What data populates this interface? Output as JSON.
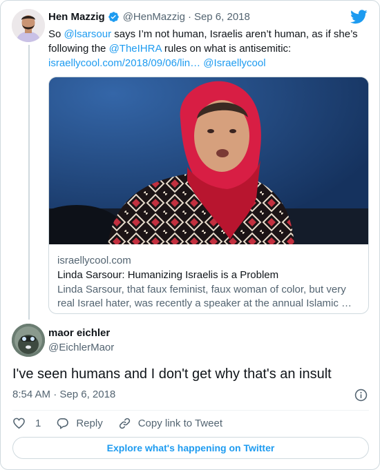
{
  "quoted_tweet": {
    "name": "Hen Mazzig",
    "handle": "@HenMazzig",
    "dot": "·",
    "date": "Sep 6, 2018",
    "text_1": "So ",
    "mention_1": "@lsarsour",
    "text_2": " says I’m not human, Israelis aren’t human, as if she’s following the ",
    "mention_2": "@TheIHRA",
    "text_3": " rules on what is antisemitic: ",
    "link_text": "israellycool.com/2018/09/06/lin…",
    "text_4": " ",
    "mention_3": "@Israellycool",
    "card": {
      "domain": "israellycool.com",
      "title": "Linda Sarsour: Humanizing Israelis is a Problem",
      "description": "Linda Sarsour, that faux feminist, faux woman of color, but very real Israel hater, was recently a speaker at the annual Islamic …"
    }
  },
  "main_tweet": {
    "name": "maor eichler",
    "handle": "@EichlerMaor",
    "text": "I've seen humans and I don't get why that's an insult",
    "timestamp": "8:54 AM · Sep 6, 2018"
  },
  "actions": {
    "like_count": "1",
    "reply_label": "Reply",
    "copy_label": "Copy link to Tweet"
  },
  "explore_label": "Explore what's happening on Twitter",
  "colors": {
    "accent": "#1d9bf0",
    "secondary_text": "#536471",
    "border": "#cfd9de",
    "scarf": "#d81e44"
  },
  "icons": [
    "verified-badge-icon",
    "twitter-bird-icon",
    "info-icon",
    "heart-icon",
    "reply-bubble-icon",
    "link-icon"
  ]
}
